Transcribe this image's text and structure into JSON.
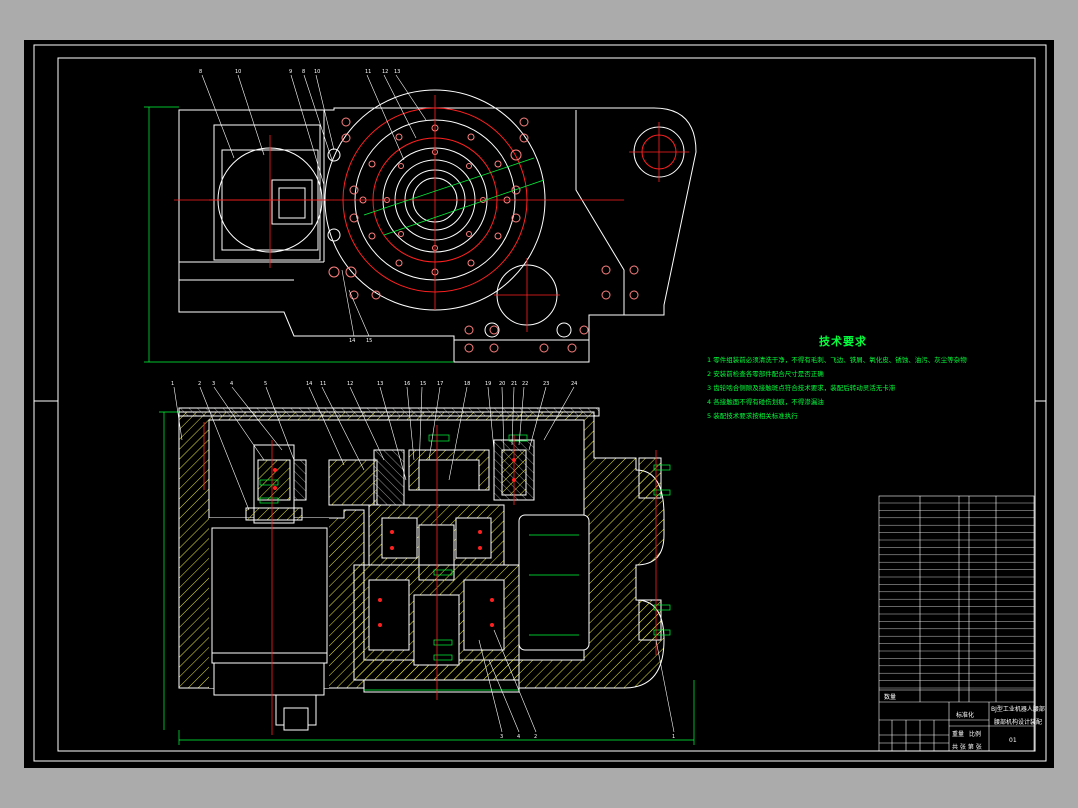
{
  "technical_requirements": {
    "title": "技术要求",
    "notes": [
      "1  零件组装前必须清洗干净，不得有毛刺、飞边、铁屑、氧化皮、锈蚀、油污、灰尘等杂物",
      "2  安装前检查各零部件配合尺寸是否正确",
      "3  齿轮啮合侧隙及接触斑点符合技术要求，装配后转动灵活无卡滞",
      "4  各接触面不得有碰伤划痕，不得渗漏油",
      "5  装配技术要求按相关标准执行"
    ]
  },
  "title_block": {
    "drawing_title_line1": "BJ型工业机器人腰部",
    "drawing_title_line2": "腰部机构设计装配",
    "drawing_number": "01",
    "label_standard": "标准化",
    "label_weight": "重量",
    "label_scale": "比例",
    "label_qty": "数量",
    "label_sheet": "共 张 第 张"
  },
  "colors": {
    "sheet": "#000000",
    "frame": "#ffffff",
    "outline": "#ffffff",
    "centerline": "#ff2020",
    "dimension": "#00ff3c",
    "hatch": "#ffff40",
    "text": "#00ff3c",
    "background": "#ababab"
  }
}
